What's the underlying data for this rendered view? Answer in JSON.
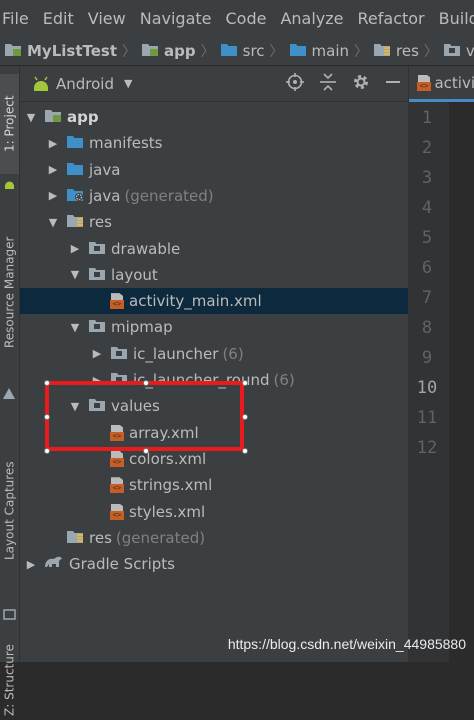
{
  "menu": [
    "File",
    "Edit",
    "View",
    "Navigate",
    "Code",
    "Analyze",
    "Refactor",
    "Build"
  ],
  "breadcrumb": [
    {
      "label": "MyListTest",
      "icon": "module-folder-icon"
    },
    {
      "label": "app",
      "icon": "module-folder-icon"
    },
    {
      "label": "src",
      "icon": "folder-icon"
    },
    {
      "label": "main",
      "icon": "folder-icon"
    },
    {
      "label": "res",
      "icon": "res-folder-icon"
    },
    {
      "label": "values",
      "icon": "package-folder-icon"
    }
  ],
  "side_strip": {
    "project": "1: Project",
    "resource_manager": "Resource Manager",
    "layout_captures": "Layout Captures",
    "structure": "Z: Structure"
  },
  "panel": {
    "view_mode": "Android"
  },
  "tree": [
    {
      "label": "app",
      "arrow": "▼",
      "depth": 0,
      "icon": "module-folder-icon",
      "bold": true
    },
    {
      "label": "manifests",
      "arrow": "▶",
      "depth": 1,
      "icon": "folder-icon"
    },
    {
      "label": "java",
      "arrow": "▶",
      "depth": 1,
      "icon": "folder-icon"
    },
    {
      "label": "java",
      "suffix": "(generated)",
      "arrow": "▶",
      "depth": 1,
      "icon": "generated-folder-icon"
    },
    {
      "label": "res",
      "arrow": "▼",
      "depth": 1,
      "icon": "res-folder-icon"
    },
    {
      "label": "drawable",
      "arrow": "▶",
      "depth": 2,
      "icon": "package-folder-icon"
    },
    {
      "label": "layout",
      "arrow": "▼",
      "depth": 2,
      "icon": "package-folder-icon"
    },
    {
      "label": "activity_main.xml",
      "arrow": "",
      "depth": 3,
      "icon": "xml-file-icon",
      "selected": true
    },
    {
      "label": "mipmap",
      "arrow": "▼",
      "depth": 2,
      "icon": "package-folder-icon"
    },
    {
      "label": "ic_launcher",
      "suffix": "(6)",
      "arrow": "▶",
      "depth": 3,
      "icon": "package-folder-icon"
    },
    {
      "label": "ic_launcher_round",
      "suffix": "(6)",
      "arrow": "▶",
      "depth": 3,
      "icon": "package-folder-icon"
    },
    {
      "label": "values",
      "arrow": "▼",
      "depth": 2,
      "icon": "package-folder-icon"
    },
    {
      "label": "array.xml",
      "arrow": "",
      "depth": 3,
      "icon": "xml-file-icon"
    },
    {
      "label": "colors.xml",
      "arrow": "",
      "depth": 3,
      "icon": "xml-file-icon"
    },
    {
      "label": "strings.xml",
      "arrow": "",
      "depth": 3,
      "icon": "xml-file-icon"
    },
    {
      "label": "styles.xml",
      "arrow": "",
      "depth": 3,
      "icon": "xml-file-icon"
    },
    {
      "label": "res",
      "suffix": "(generated)",
      "arrow": "",
      "depth": 1,
      "icon": "res-folder-icon"
    },
    {
      "label": "Gradle Scripts",
      "arrow": "▶",
      "depth": 0,
      "icon": "gradle-icon"
    }
  ],
  "editor": {
    "tab_label": "activi",
    "line_numbers": [
      "1",
      "2",
      "3",
      "4",
      "5",
      "6",
      "7",
      "8",
      "9",
      "10",
      "11",
      "12"
    ],
    "current_line": "10"
  },
  "watermark": "https://blog.csdn.net/weixin_44985880",
  "colors": {
    "highlight": "#e81c1c",
    "selection": "#0d293e",
    "background": "#3c3f41"
  }
}
